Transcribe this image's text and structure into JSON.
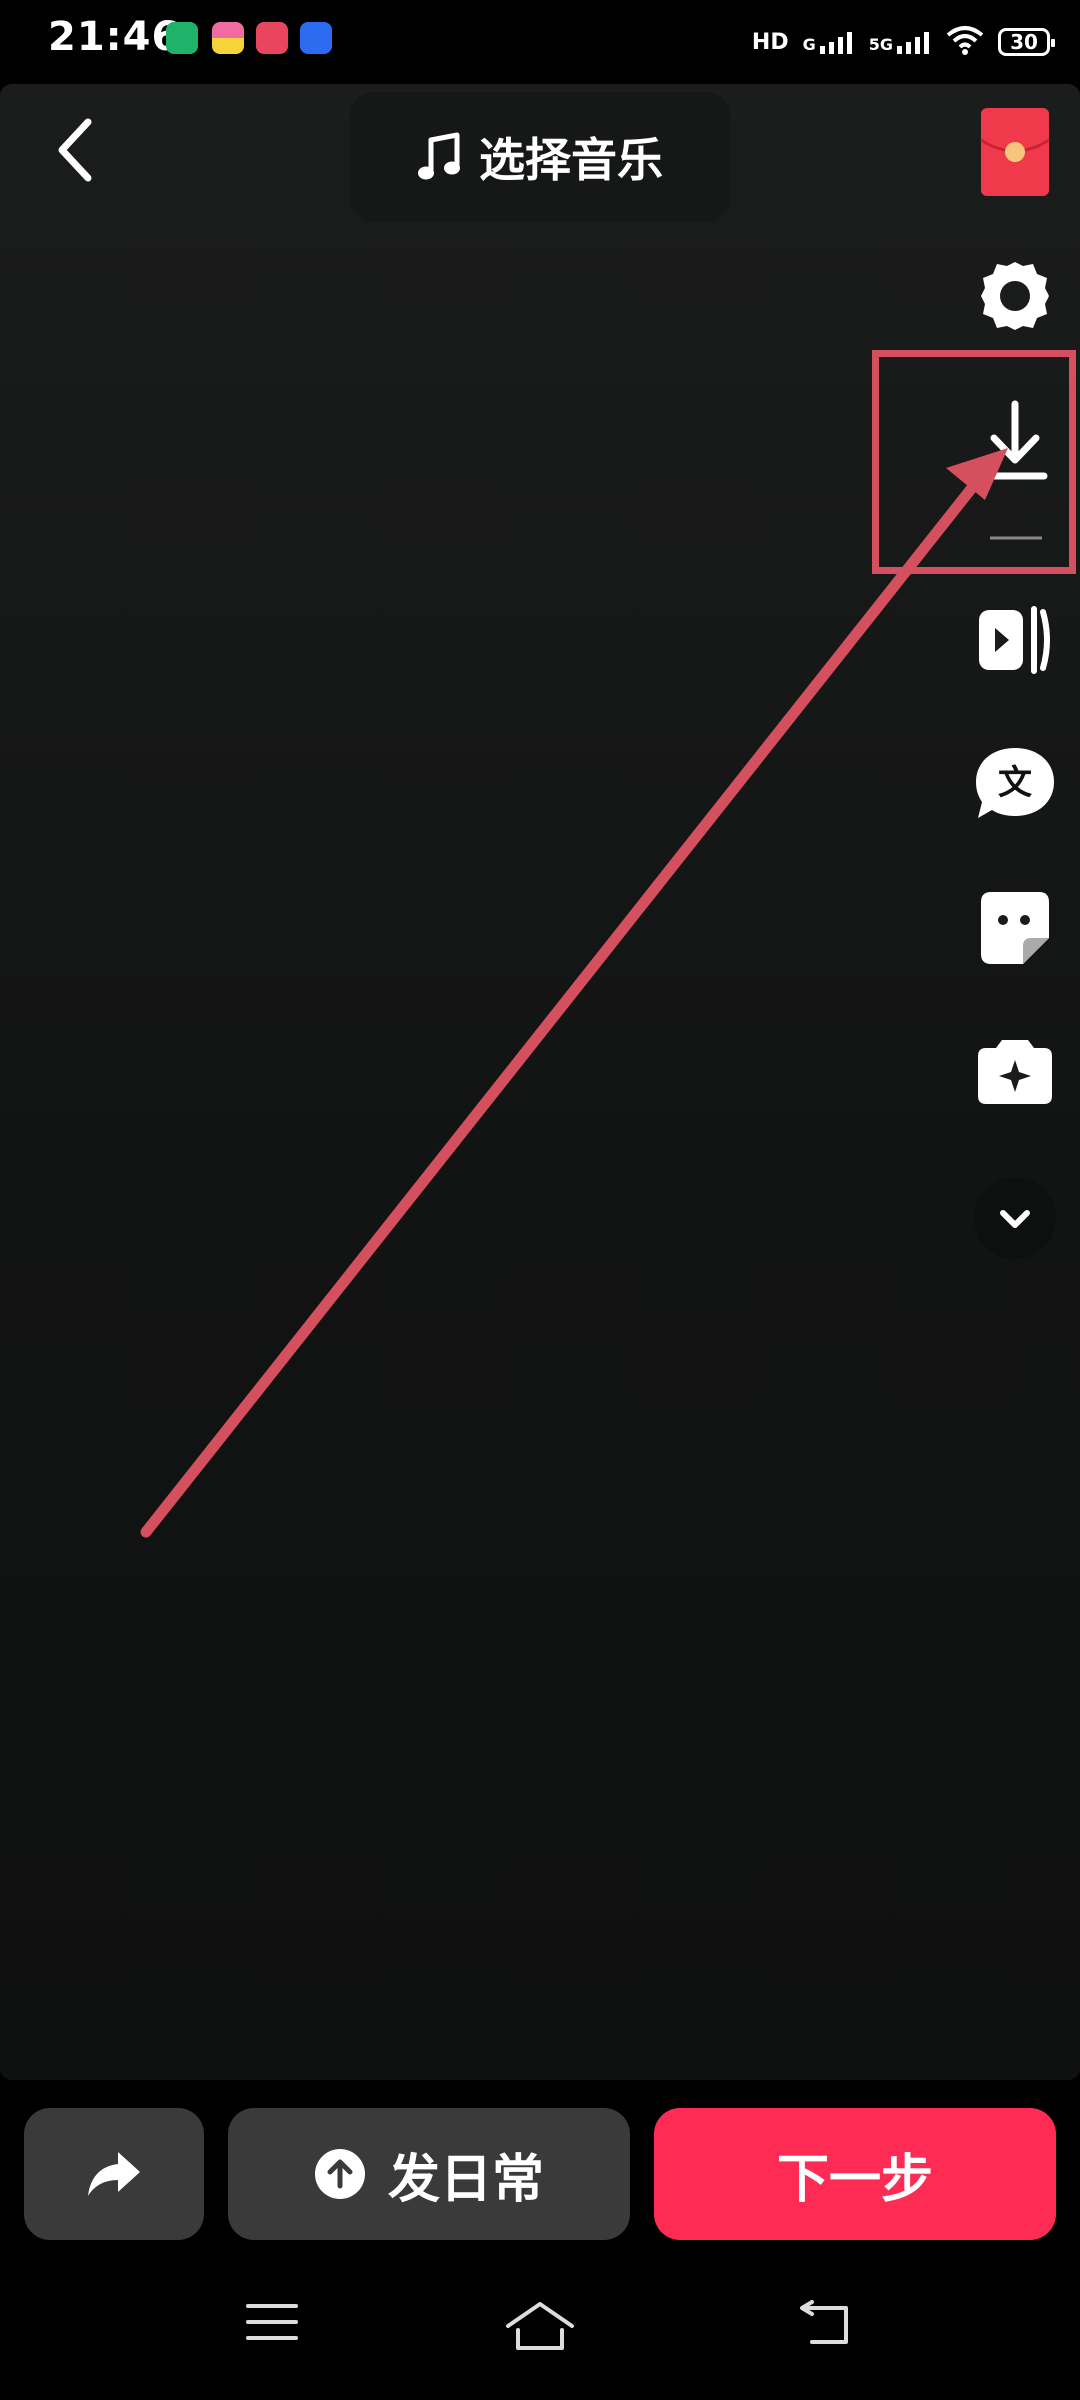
{
  "status_bar": {
    "time": "21:46",
    "hd_label": "HD",
    "network_g": "G",
    "network_5g": "5G",
    "battery": "30",
    "app_icons": [
      "iqiyi-icon",
      "game-center-icon",
      "red-app-icon",
      "blue-app-icon"
    ]
  },
  "header": {
    "music_label": "选择音乐"
  },
  "side_toolbar": {
    "items": [
      "red-envelope-icon",
      "settings-gear-icon",
      "download-icon",
      "video-flip-icon",
      "text-bubble-icon",
      "sticker-icon",
      "camera-effects-icon",
      "expand-more-icon"
    ]
  },
  "bottom": {
    "daily_label": "发日常",
    "next_label": "下一步"
  },
  "colors": {
    "accent": "#fe2c55",
    "annotation": "#d5505e",
    "button_bg": "#3a3a3a"
  }
}
